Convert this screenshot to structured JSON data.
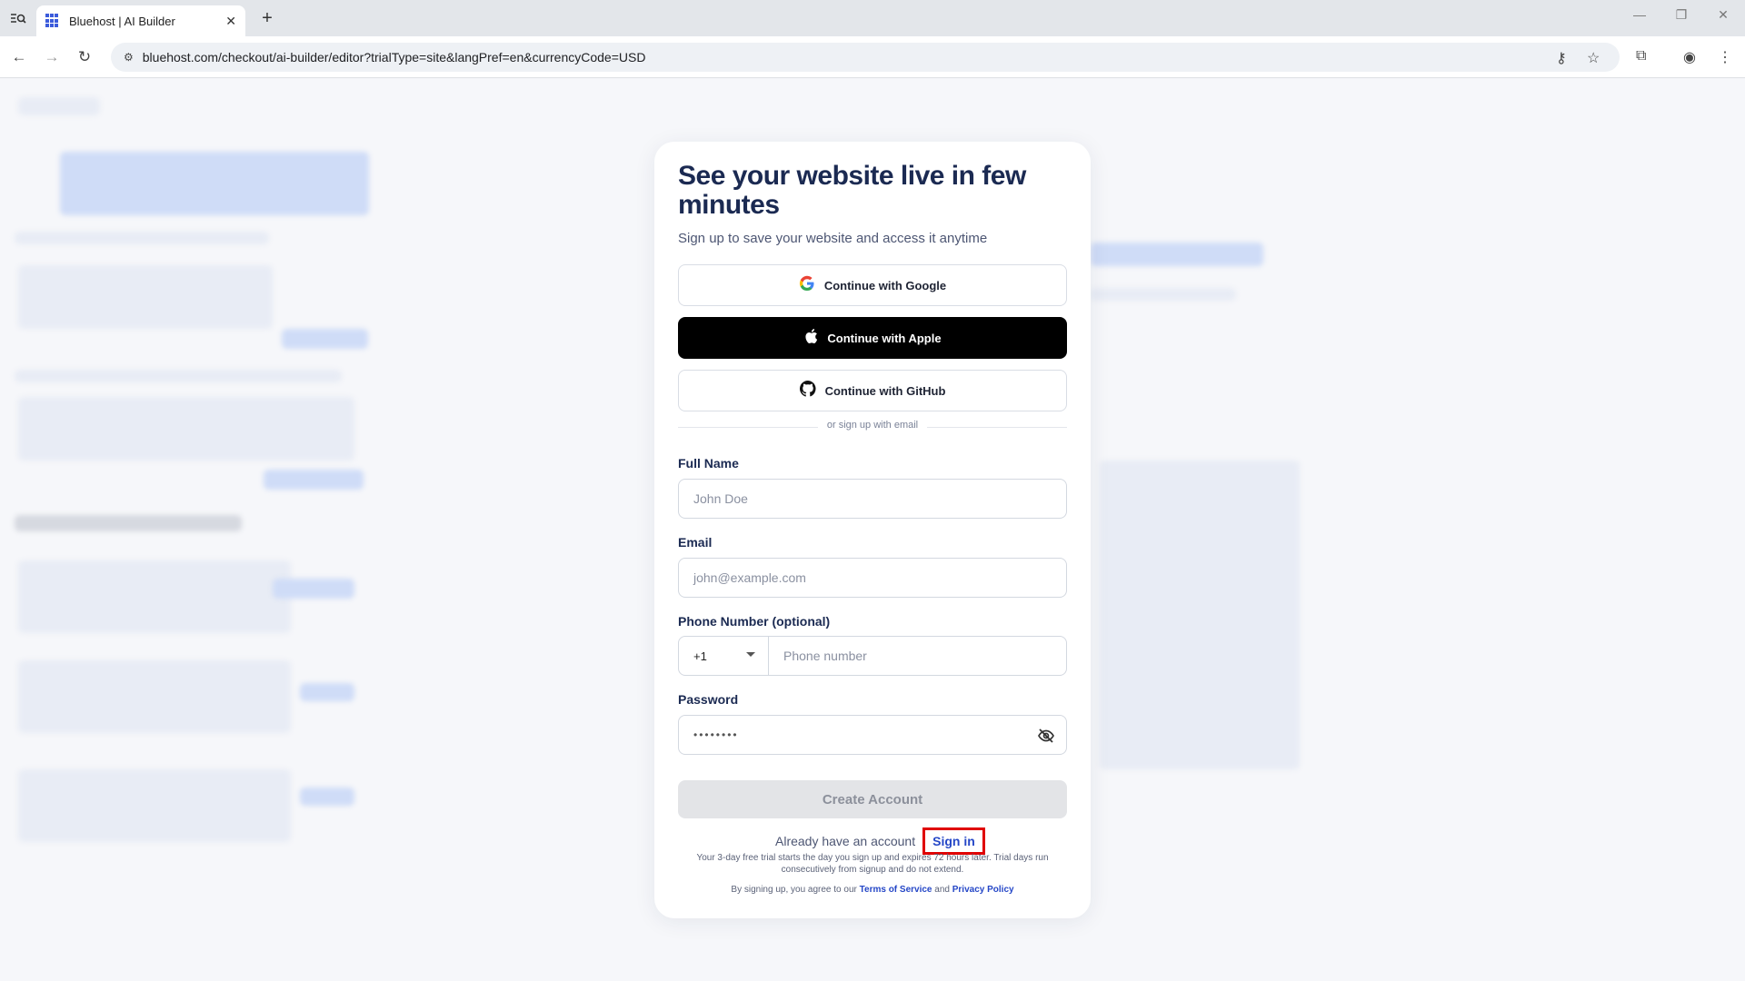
{
  "browser": {
    "tab_title": "Bluehost | AI Builder",
    "url": "bluehost.com/checkout/ai-builder/editor?trialType=site&langPref=en&currencyCode=USD"
  },
  "modal": {
    "title": "See your website live in few minutes",
    "subtitle": "Sign up to save your website and access it anytime",
    "google_label": "Continue with Google",
    "apple_label": "Continue with Apple",
    "github_label": "Continue with GitHub",
    "divider_text": "or sign up with email",
    "full_name_label": "Full Name",
    "full_name_placeholder": "John Doe",
    "email_label": "Email",
    "email_placeholder": "john@example.com",
    "phone_label": "Phone Number (optional)",
    "country_code": "+1",
    "phone_placeholder": "Phone number",
    "password_label": "Password",
    "password_value": "••••••••",
    "create_label": "Create Account",
    "already_text": "Already have an account",
    "signin_label": "Sign in",
    "trial_text": "Your 3-day free trial starts the day you sign up and expires 72 hours later. Trial days run consecutively from signup and do not extend.",
    "terms_prefix": "By signing up, you agree to our",
    "terms_link": "Terms of Service",
    "terms_and": "and",
    "privacy_link": "Privacy Policy"
  },
  "colors": {
    "title": "#1b2a52",
    "link": "#2547c7",
    "highlight": "#e00000"
  }
}
